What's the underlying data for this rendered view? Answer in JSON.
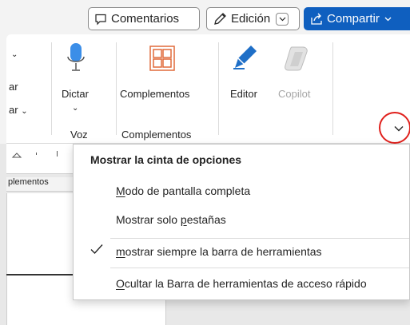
{
  "titlebar": {
    "comments_label": "Comentarios",
    "edit_label": "Edición",
    "share_label": "Compartir"
  },
  "ribbon": {
    "partial_labels": [
      "ar",
      "ar"
    ],
    "dictate": {
      "label": "Dictar",
      "group": "Voz"
    },
    "addins": {
      "label": "Complementos",
      "group": "Complementos"
    },
    "editor_label": "Editor",
    "copilot_label": "Copilot"
  },
  "document": {
    "ruler_label": "plementos"
  },
  "menu": {
    "title": "Mostrar la cinta de opciones",
    "items": [
      {
        "before": "",
        "accel": "M",
        "after": "odo de pantalla completa",
        "checked": false
      },
      {
        "before": "Mostrar solo ",
        "accel": "p",
        "after": "estañas",
        "checked": false
      },
      {
        "before": "",
        "accel": "m",
        "after": "ostrar siempre la barra de herramientas",
        "checked": true
      },
      {
        "before": "",
        "accel": "O",
        "after": "cultar la Barra de herramientas de acceso rápido",
        "checked": false
      }
    ]
  },
  "colors": {
    "accent": "#0f5fbf",
    "highlight_circle": "#e0201c",
    "copilot_text": "#a6a6a6"
  },
  "icons": [
    "comment-icon",
    "pen-icon",
    "share-icon",
    "chevron-down-icon",
    "microphone-icon",
    "addins-grid-icon",
    "editor-pen-icon",
    "copilot-icon",
    "checkmark-icon"
  ]
}
